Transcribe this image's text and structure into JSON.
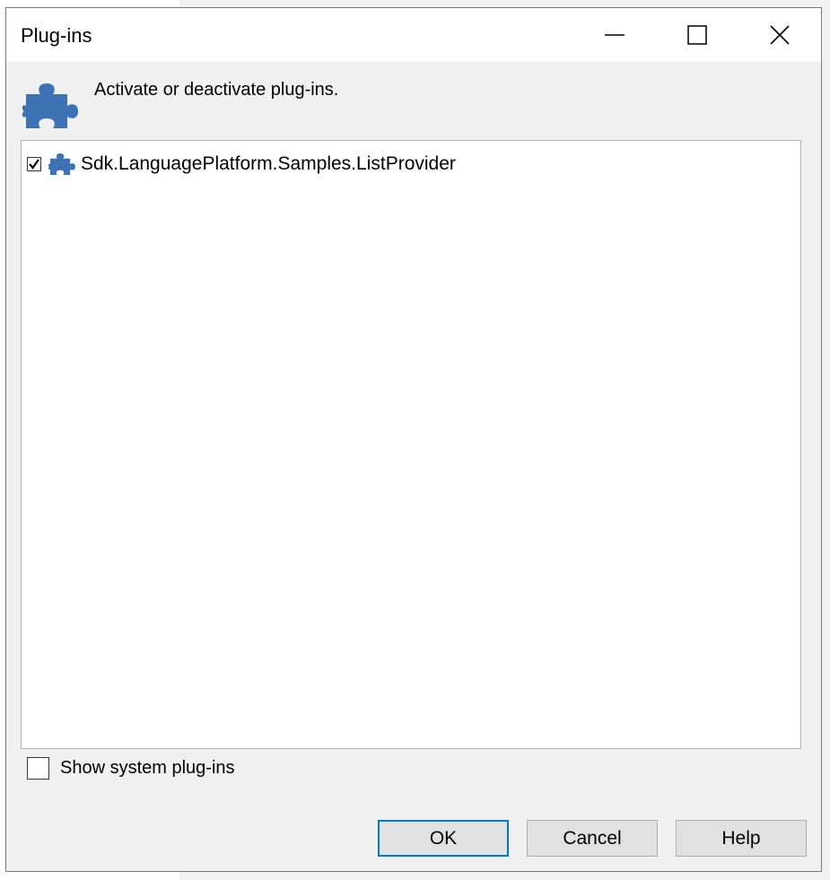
{
  "window": {
    "title": "Plug-ins",
    "controls": {
      "minimize_icon": "minimize-icon",
      "maximize_icon": "maximize-icon",
      "close_icon": "close-icon"
    }
  },
  "header": {
    "icon": "puzzle-icon",
    "text": "Activate or deactivate plug-ins."
  },
  "plugins": [
    {
      "label": "Sdk.LanguagePlatform.Samples.ListProvider",
      "checked": true,
      "icon": "puzzle-icon"
    }
  ],
  "options": {
    "show_system_label": "Show system plug-ins",
    "show_system_checked": false
  },
  "buttons": {
    "ok": "OK",
    "cancel": "Cancel",
    "help": "Help"
  },
  "colors": {
    "accent": "#0078d7",
    "icon": "#3d72b4"
  }
}
